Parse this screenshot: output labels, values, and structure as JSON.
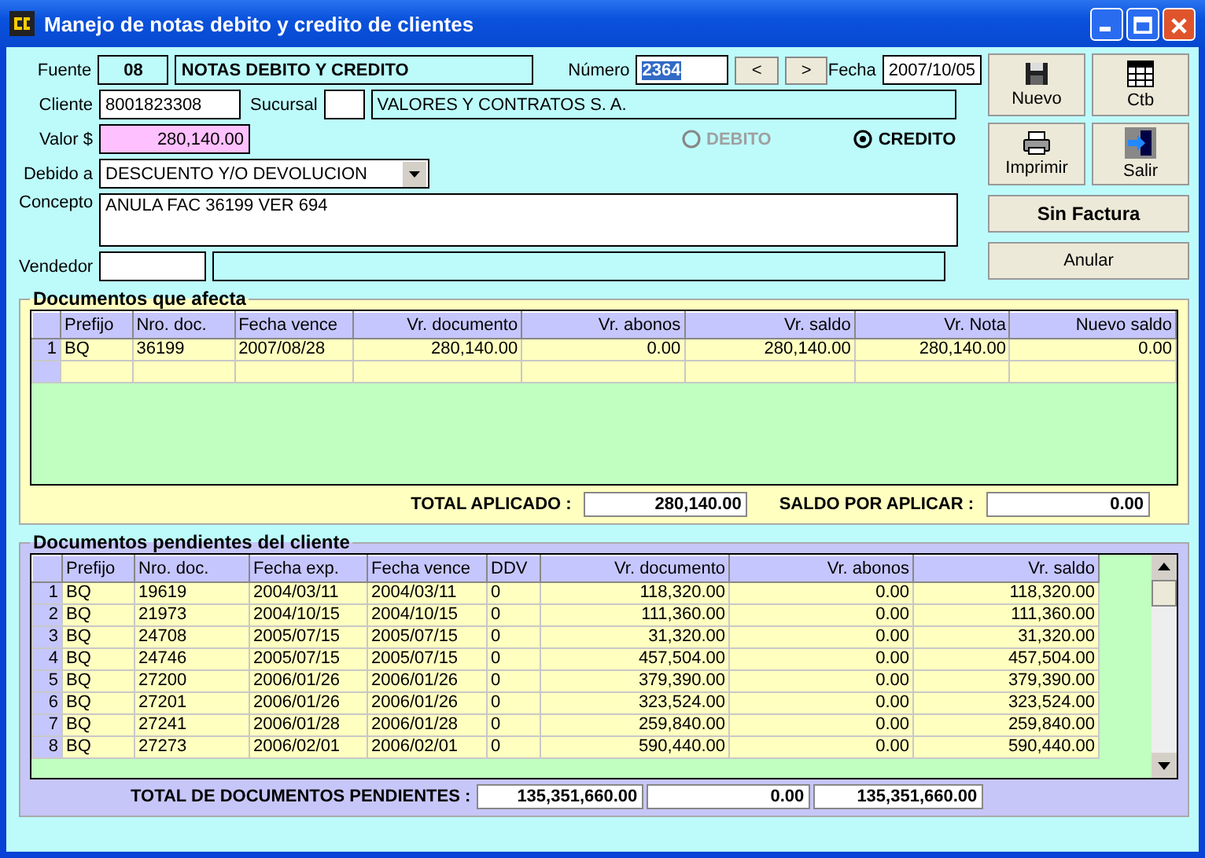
{
  "window": {
    "title": "Manejo de notas debito y credito de clientes"
  },
  "form": {
    "fuente": {
      "label": "Fuente",
      "code": "08",
      "name": "NOTAS DEBITO Y CREDITO"
    },
    "numero": {
      "label": "Número",
      "value": "2364",
      "selected": true
    },
    "nav": [
      "<",
      ">"
    ],
    "fecha": {
      "label": "Fecha",
      "value": "2007/10/05"
    },
    "cliente": {
      "label": "Cliente",
      "value": "8001823308"
    },
    "sucursal": {
      "label": "Sucursal",
      "name": "VALORES Y CONTRATOS S. A."
    },
    "valor": {
      "label": "Valor $",
      "value": "280,140.00"
    },
    "tipo": [
      {
        "label": "DEBITO",
        "selected": false,
        "disabled": true
      },
      {
        "label": "CREDITO",
        "selected": true,
        "disabled": false
      }
    ],
    "debido_a": {
      "label": "Debido a",
      "value": "DESCUENTO Y/O DEVOLUCION"
    },
    "concepto": {
      "label": "Concepto",
      "value": "ANULA FAC 36199 VER 694"
    },
    "vendedor": {
      "label": "Vendedor"
    }
  },
  "buttons": [
    {
      "label": "Nuevo",
      "kind": "tool"
    },
    {
      "label": "Ctb",
      "kind": "tool"
    },
    {
      "label": "Imprimir",
      "kind": "tool"
    },
    {
      "label": "Salir",
      "kind": "tool"
    },
    {
      "label": "Sin Factura",
      "kind": "bold"
    },
    {
      "label": "Anular",
      "kind": "plain"
    }
  ],
  "afecta": {
    "title": "Documentos que afecta",
    "columns": [
      "Prefijo",
      "Nro. doc.",
      "Fecha vence",
      "Vr. documento",
      "Vr. abonos",
      "Vr. saldo",
      "Vr. Nota",
      "Nuevo saldo"
    ],
    "rows": [
      {
        "num": "1",
        "cells": [
          "BQ",
          "36199",
          "2007/08/28",
          "280,140.00",
          "0.00",
          "280,140.00",
          "280,140.00",
          "0.00"
        ]
      }
    ],
    "totals": [
      {
        "label": "TOTAL APLICADO :",
        "value": "280,140.00"
      },
      {
        "label": "SALDO POR APLICAR :",
        "value": "0.00"
      }
    ]
  },
  "pendientes": {
    "title": "Documentos pendientes del cliente",
    "columns": [
      "Prefijo",
      "Nro. doc.",
      "Fecha exp.",
      "Fecha vence",
      "DDV",
      "Vr. documento",
      "Vr. abonos",
      "Vr. saldo"
    ],
    "rows": [
      {
        "num": "1",
        "cells": [
          "BQ",
          "19619",
          "2004/03/11",
          "2004/03/11",
          "0",
          "118,320.00",
          "0.00",
          "118,320.00"
        ]
      },
      {
        "num": "2",
        "cells": [
          "BQ",
          "21973",
          "2004/10/15",
          "2004/10/15",
          "0",
          "111,360.00",
          "0.00",
          "111,360.00"
        ]
      },
      {
        "num": "3",
        "cells": [
          "BQ",
          "24708",
          "2005/07/15",
          "2005/07/15",
          "0",
          "31,320.00",
          "0.00",
          "31,320.00"
        ]
      },
      {
        "num": "4",
        "cells": [
          "BQ",
          "24746",
          "2005/07/15",
          "2005/07/15",
          "0",
          "457,504.00",
          "0.00",
          "457,504.00"
        ]
      },
      {
        "num": "5",
        "cells": [
          "BQ",
          "27200",
          "2006/01/26",
          "2006/01/26",
          "0",
          "379,390.00",
          "0.00",
          "379,390.00"
        ]
      },
      {
        "num": "6",
        "cells": [
          "BQ",
          "27201",
          "2006/01/26",
          "2006/01/26",
          "0",
          "323,524.00",
          "0.00",
          "323,524.00"
        ]
      },
      {
        "num": "7",
        "cells": [
          "BQ",
          "27241",
          "2006/01/28",
          "2006/01/28",
          "0",
          "259,840.00",
          "0.00",
          "259,840.00"
        ]
      },
      {
        "num": "8",
        "cells": [
          "BQ",
          "27273",
          "2006/02/01",
          "2006/02/01",
          "0",
          "590,440.00",
          "0.00",
          "590,440.00"
        ]
      }
    ],
    "totals_label": "TOTAL  DE DOCUMENTOS PENDIENTES :",
    "totals": [
      "135,351,660.00",
      "0.00",
      "135,351,660.00"
    ]
  }
}
